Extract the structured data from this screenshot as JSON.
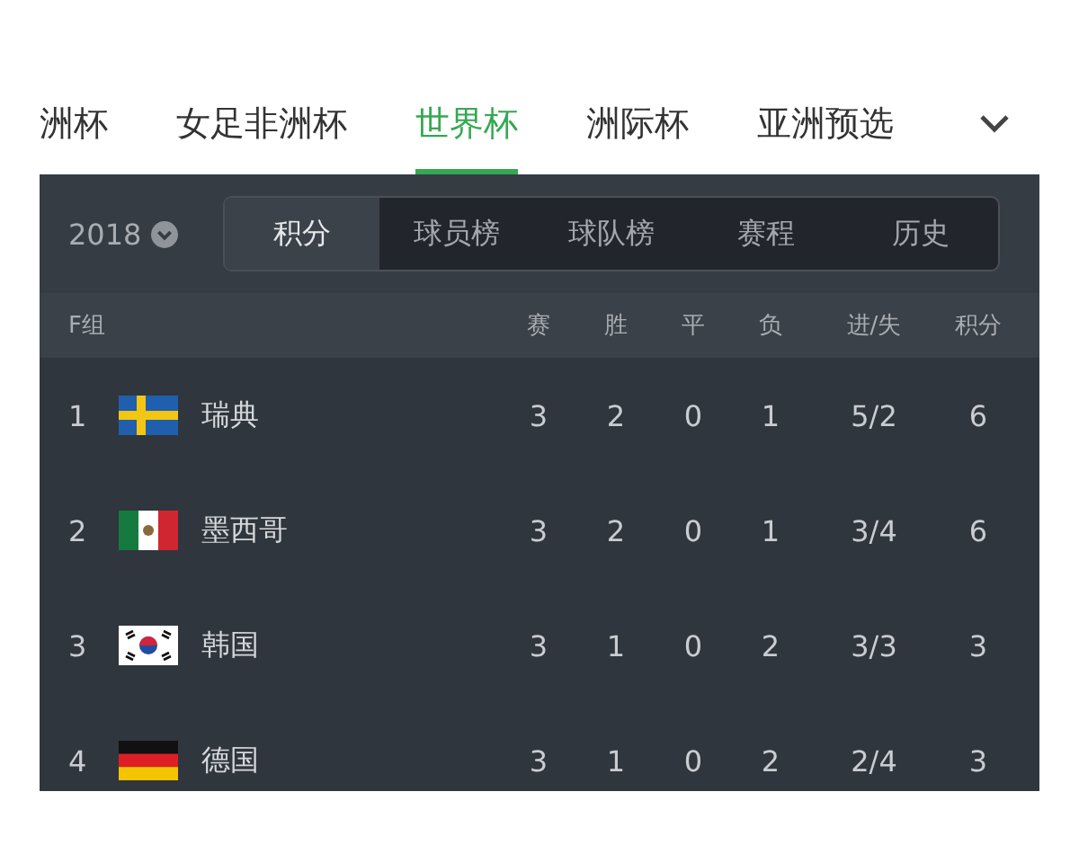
{
  "tabs": [
    {
      "label": "洲杯",
      "selected": false
    },
    {
      "label": "女足非洲杯",
      "selected": false
    },
    {
      "label": "世界杯",
      "selected": true
    },
    {
      "label": "洲际杯",
      "selected": false
    },
    {
      "label": "亚洲预选",
      "selected": false
    }
  ],
  "year": "2018",
  "segments": [
    {
      "label": "积分",
      "selected": true
    },
    {
      "label": "球员榜",
      "selected": false
    },
    {
      "label": "球队榜",
      "selected": false
    },
    {
      "label": "赛程",
      "selected": false
    },
    {
      "label": "历史",
      "selected": false
    }
  ],
  "table": {
    "group": "F组",
    "columns": [
      "赛",
      "胜",
      "平",
      "负",
      "进/失",
      "积分"
    ],
    "rows": [
      {
        "rank": "1",
        "team": "瑞典",
        "cells": [
          "3",
          "2",
          "0",
          "1",
          "5/2",
          "6"
        ]
      },
      {
        "rank": "2",
        "team": "墨西哥",
        "cells": [
          "3",
          "2",
          "0",
          "1",
          "3/4",
          "6"
        ]
      },
      {
        "rank": "3",
        "team": "韩国",
        "cells": [
          "3",
          "1",
          "0",
          "2",
          "3/3",
          "3"
        ]
      },
      {
        "rank": "4",
        "team": "德国",
        "cells": [
          "3",
          "1",
          "0",
          "2",
          "2/4",
          "3"
        ]
      }
    ]
  }
}
